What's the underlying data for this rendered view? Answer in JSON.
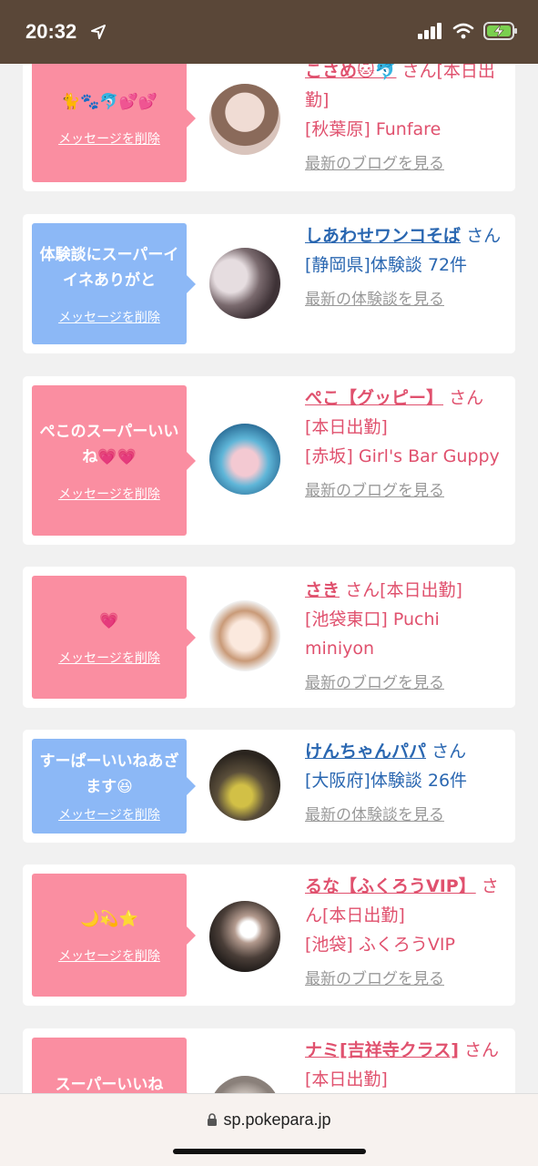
{
  "status": {
    "time": "20:32"
  },
  "url": "sp.pokepara.jp",
  "delete_label": "メッセージを削除",
  "cards": [
    {
      "bubble_color": "pink",
      "message": "🐈🐾🐬💕💕",
      "name": "こさめ🐱🐬",
      "suffix": "さん[本日出勤]",
      "detail": "[秋葉原] Funfare",
      "link": "最新のブログを見る",
      "avatar_colors": [
        "#e8d2cb",
        "#8a6a5a"
      ]
    },
    {
      "bubble_color": "blue",
      "message": "体験談にスーパーイイネありがと",
      "name": "しあわせワンコそば",
      "suffix": "さん",
      "detail": "[静岡県]体験談 72件",
      "link": "最新の体験談を見る",
      "avatar_colors": [
        "#cfc3c7",
        "#4a3c40"
      ]
    },
    {
      "bubble_color": "pink",
      "message": "ぺこのスーパーいいね💗💗",
      "name": "ぺこ【グッピー】",
      "suffix": "さん[本日出勤]",
      "detail": "[赤坂] Girl's Bar Guppy",
      "link": "最新のブログを見る",
      "avatar_colors": [
        "#5fb6d8",
        "#2a6c96"
      ]
    },
    {
      "bubble_color": "pink",
      "message": "💗",
      "name": "さき",
      "suffix": "さん[本日出勤]",
      "detail": "[池袋東口] Puchi miniyon",
      "link": "最新のブログを見る",
      "avatar_colors": [
        "#f5e3d5",
        "#b88a6a"
      ]
    },
    {
      "bubble_color": "blue",
      "message": "すーぱーいいねあざます😆",
      "name": "けんちゃんパパ",
      "suffix": "さん",
      "detail": "[大阪府]体験談 26件",
      "link": "最新の体験談を見る",
      "avatar_colors": [
        "#3a3228",
        "#c9b14a"
      ]
    },
    {
      "bubble_color": "pink",
      "message": "🌙💫⭐",
      "name": "るな【ふくろうVIP】",
      "suffix": "さん[本日出勤]",
      "detail": "[池袋] ふくろうVIP",
      "link": "最新のブログを見る",
      "avatar_colors": [
        "#2a2420",
        "#8a7064"
      ]
    },
    {
      "bubble_color": "pink",
      "message": "スーパーいいね",
      "name": "ナミ[吉祥寺クラス]",
      "suffix": "さん[本日出勤]",
      "detail": "",
      "link": "",
      "avatar_colors": [
        "#b9b0aa",
        "#6b625c"
      ]
    }
  ]
}
